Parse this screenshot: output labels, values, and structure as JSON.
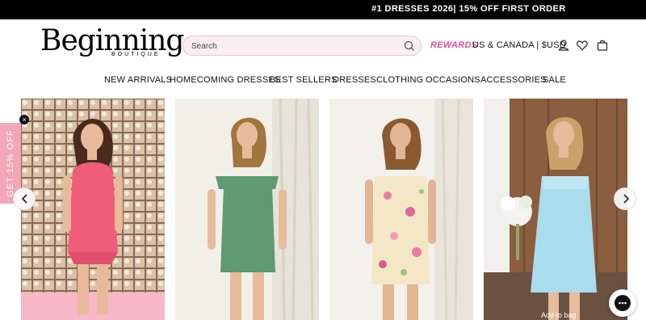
{
  "announcement": "#1 DRESSES 2026| 15% OFF FIRST ORDER",
  "logo": {
    "main": "Beginning",
    "sub": "BOUTIQUE"
  },
  "search": {
    "placeholder": "Search"
  },
  "header": {
    "rewards": "REWARDS",
    "region": "US & CANADA | $USD",
    "icons": [
      "search-icon",
      "account-icon",
      "wishlist-heart-icon",
      "cart-bag-icon"
    ]
  },
  "nav": [
    "NEW ARRIVALS",
    "HOMECOMING DRESSES",
    "BEST SELLERS",
    "DRESSES",
    "CLOTHING",
    "OCCASIONS",
    "ACCESSORIES",
    "SALE"
  ],
  "products": [
    {
      "name": "pink-satin-dress",
      "dress_color": "#f05d7a"
    },
    {
      "name": "green-satin-dress",
      "dress_color": "#5f9a73"
    },
    {
      "name": "floral-dress",
      "dress_color": "#f3e7c6"
    },
    {
      "name": "blue-satin-dress",
      "dress_color": "#a9dcec"
    }
  ],
  "promo_tab": "GET 15% OFF",
  "add_to_bag": "Add to bag",
  "colors": {
    "accent_pink": "#e0519a",
    "announce_bg": "#000000",
    "promo_pink": "#f2a6b8"
  }
}
